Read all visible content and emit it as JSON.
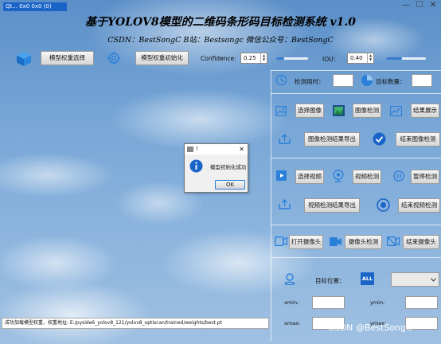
{
  "window": {
    "title_label": "Qt... 0x0 0x0 (0)",
    "close_symbol": "✕",
    "minimize_symbol": "—",
    "maximize_symbol": "☐"
  },
  "header": {
    "title": "基于YOLOV8模型的二维码条形码目标检测系统 v1.0",
    "subtitle": "CSDN：BestSongC   B站：Bestsongc   微信公众号：BestSongC"
  },
  "toolbar": {
    "select_weights_label": "模型权重选择",
    "init_weights_label": "模型权重初始化",
    "confidence_label": "Confidence:",
    "confidence_value": "0.25",
    "confidence_level": 0.25,
    "iou_label": "IOU：",
    "iou_value": "0.40",
    "iou_level": 0.4
  },
  "stats": {
    "detect_time_label": "检测用时：",
    "detect_time_value": "",
    "target_count_label": "目标数量：",
    "target_count_value": ""
  },
  "image_section": {
    "select_image": "选择图像",
    "detect_image": "图像检测",
    "show_result": "结果展示",
    "export_result": "图像检测结果导出",
    "end_detect": "结束图像检测"
  },
  "video_section": {
    "select_video": "选择视频",
    "detect_video": "视频检测",
    "pause_detect": "暂停检测",
    "export_result": "视频检测结果导出",
    "end_detect": "结束视频检测"
  },
  "camera_section": {
    "open_camera": "打开摄像头",
    "camera_detect": "摄像头检测",
    "close_camera": "结束摄像头"
  },
  "target_section": {
    "position_label": "目标位置：",
    "all_badge": "ALL",
    "select_value": "",
    "xmin_label": "xmin:",
    "ymin_label": "ymin:",
    "xmax_label": "xmax:",
    "ymax_label": "ymax:",
    "xmin_value": "",
    "ymin_value": "",
    "xmax_value": "",
    "ymax_value": ""
  },
  "status": {
    "message": "成功加载模型权重，权重地址: E:/pyside6_yolov8_121/yolov8_optiscan/trained/weights/best.pt"
  },
  "dialog": {
    "title": "!",
    "message": "模型初始化成功",
    "ok_label": "OK",
    "close_symbol": "✕"
  },
  "watermark": "CSDN @BestSongC",
  "colors": {
    "accent": "#1a64c8",
    "icon_blue": "#2a7fd8",
    "sky_top": "#5b8fc8",
    "sky_bottom": "#9fc0e2"
  }
}
